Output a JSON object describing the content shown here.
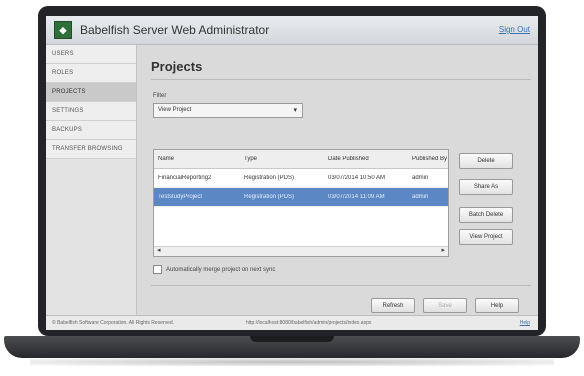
{
  "window": {
    "title": "Babelfish Server Web Administrator",
    "sign_out": "Sign Out"
  },
  "sidebar": {
    "items": [
      {
        "label": "USERS"
      },
      {
        "label": "ROLES"
      },
      {
        "label": "PROJECTS"
      },
      {
        "label": "SETTINGS"
      },
      {
        "label": "BACKUPS"
      },
      {
        "label": "TRANSFER BROWSING"
      }
    ],
    "active_index": 2
  },
  "main": {
    "page_title": "Projects",
    "filter": {
      "label": "Filter",
      "selected": "View Project"
    },
    "table": {
      "columns": [
        "Name",
        "Type",
        "Date Published",
        "Published By"
      ],
      "rows": [
        [
          "FinancialReporting2",
          "Registration (PDS)",
          "03/07/2014 10:50 AM",
          "admin"
        ],
        [
          "TeststudyProject",
          "Registration (PDS)",
          "03/07/2014 11:09 AM",
          "admin"
        ]
      ],
      "selected_row": 1
    },
    "side_buttons": {
      "delete": "Delete",
      "share_as": "Share As",
      "batch_delete": "Batch Delete",
      "view_project": "View Project"
    },
    "checkbox_label": "Automatically merge project on next sync",
    "dialog_buttons": {
      "refresh": "Refresh",
      "save": "Save",
      "help": "Help"
    }
  },
  "statusbar": {
    "copyright": "© Babelfish Software Corporation. All Rights Reserved.",
    "url": "http://localhost:8080/babelfish/admin/projects/index.aspx",
    "help": "Help"
  },
  "colors": {
    "selection": "#5b87c5",
    "logo": "#2f6f3a",
    "link": "#3a6fb0"
  }
}
